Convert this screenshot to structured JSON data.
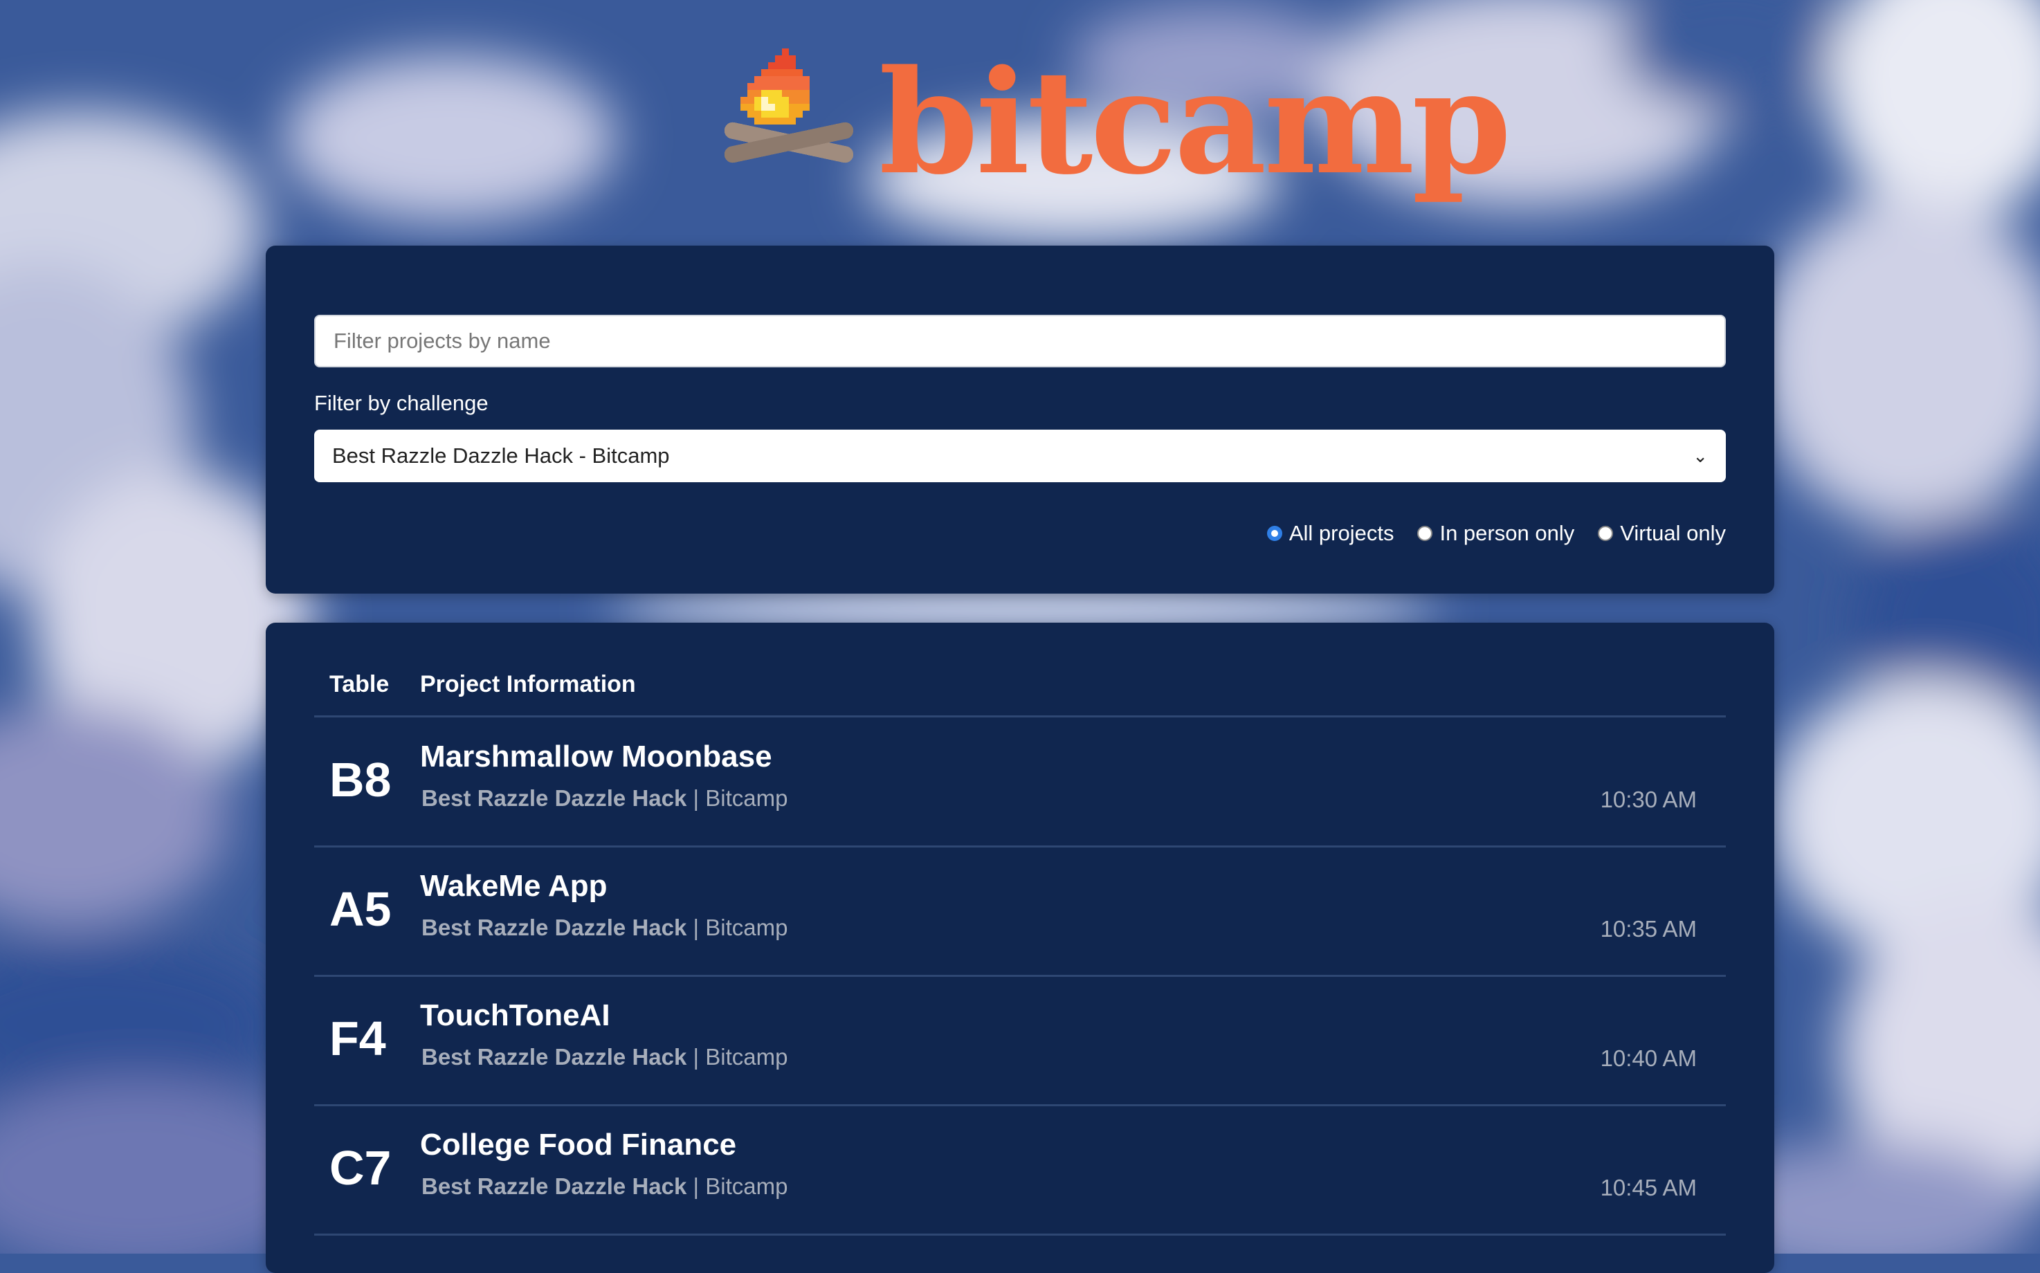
{
  "brand": {
    "name": "bitcamp",
    "logo_icon": "campfire-icon"
  },
  "filters": {
    "search_placeholder": "Filter projects by name",
    "challenge_label": "Filter by challenge",
    "challenge_selected": "Best Razzle Dazzle Hack - Bitcamp",
    "mode_options": [
      {
        "label": "All projects",
        "checked": true
      },
      {
        "label": "In person only",
        "checked": false
      },
      {
        "label": "Virtual only",
        "checked": false
      }
    ]
  },
  "table": {
    "headers": {
      "table": "Table",
      "info": "Project Information"
    },
    "separator": "|",
    "rows": [
      {
        "table": "B8",
        "name": "Marshmallow Moonbase",
        "challenge": "Best Razzle Dazzle Hack",
        "sponsor": "Bitcamp",
        "time": "10:30 AM"
      },
      {
        "table": "A5",
        "name": "WakeMe App",
        "challenge": "Best Razzle Dazzle Hack",
        "sponsor": "Bitcamp",
        "time": "10:35 AM"
      },
      {
        "table": "F4",
        "name": "TouchToneAI",
        "challenge": "Best Razzle Dazzle Hack",
        "sponsor": "Bitcamp",
        "time": "10:40 AM"
      },
      {
        "table": "C7",
        "name": "College Food Finance",
        "challenge": "Best Razzle Dazzle Hack",
        "sponsor": "Bitcamp",
        "time": "10:45 AM"
      }
    ]
  },
  "colors": {
    "panel": "#10264f",
    "brand": "#f26c3f",
    "accent": "#2f7fe6",
    "muted": "#a7aebb"
  }
}
